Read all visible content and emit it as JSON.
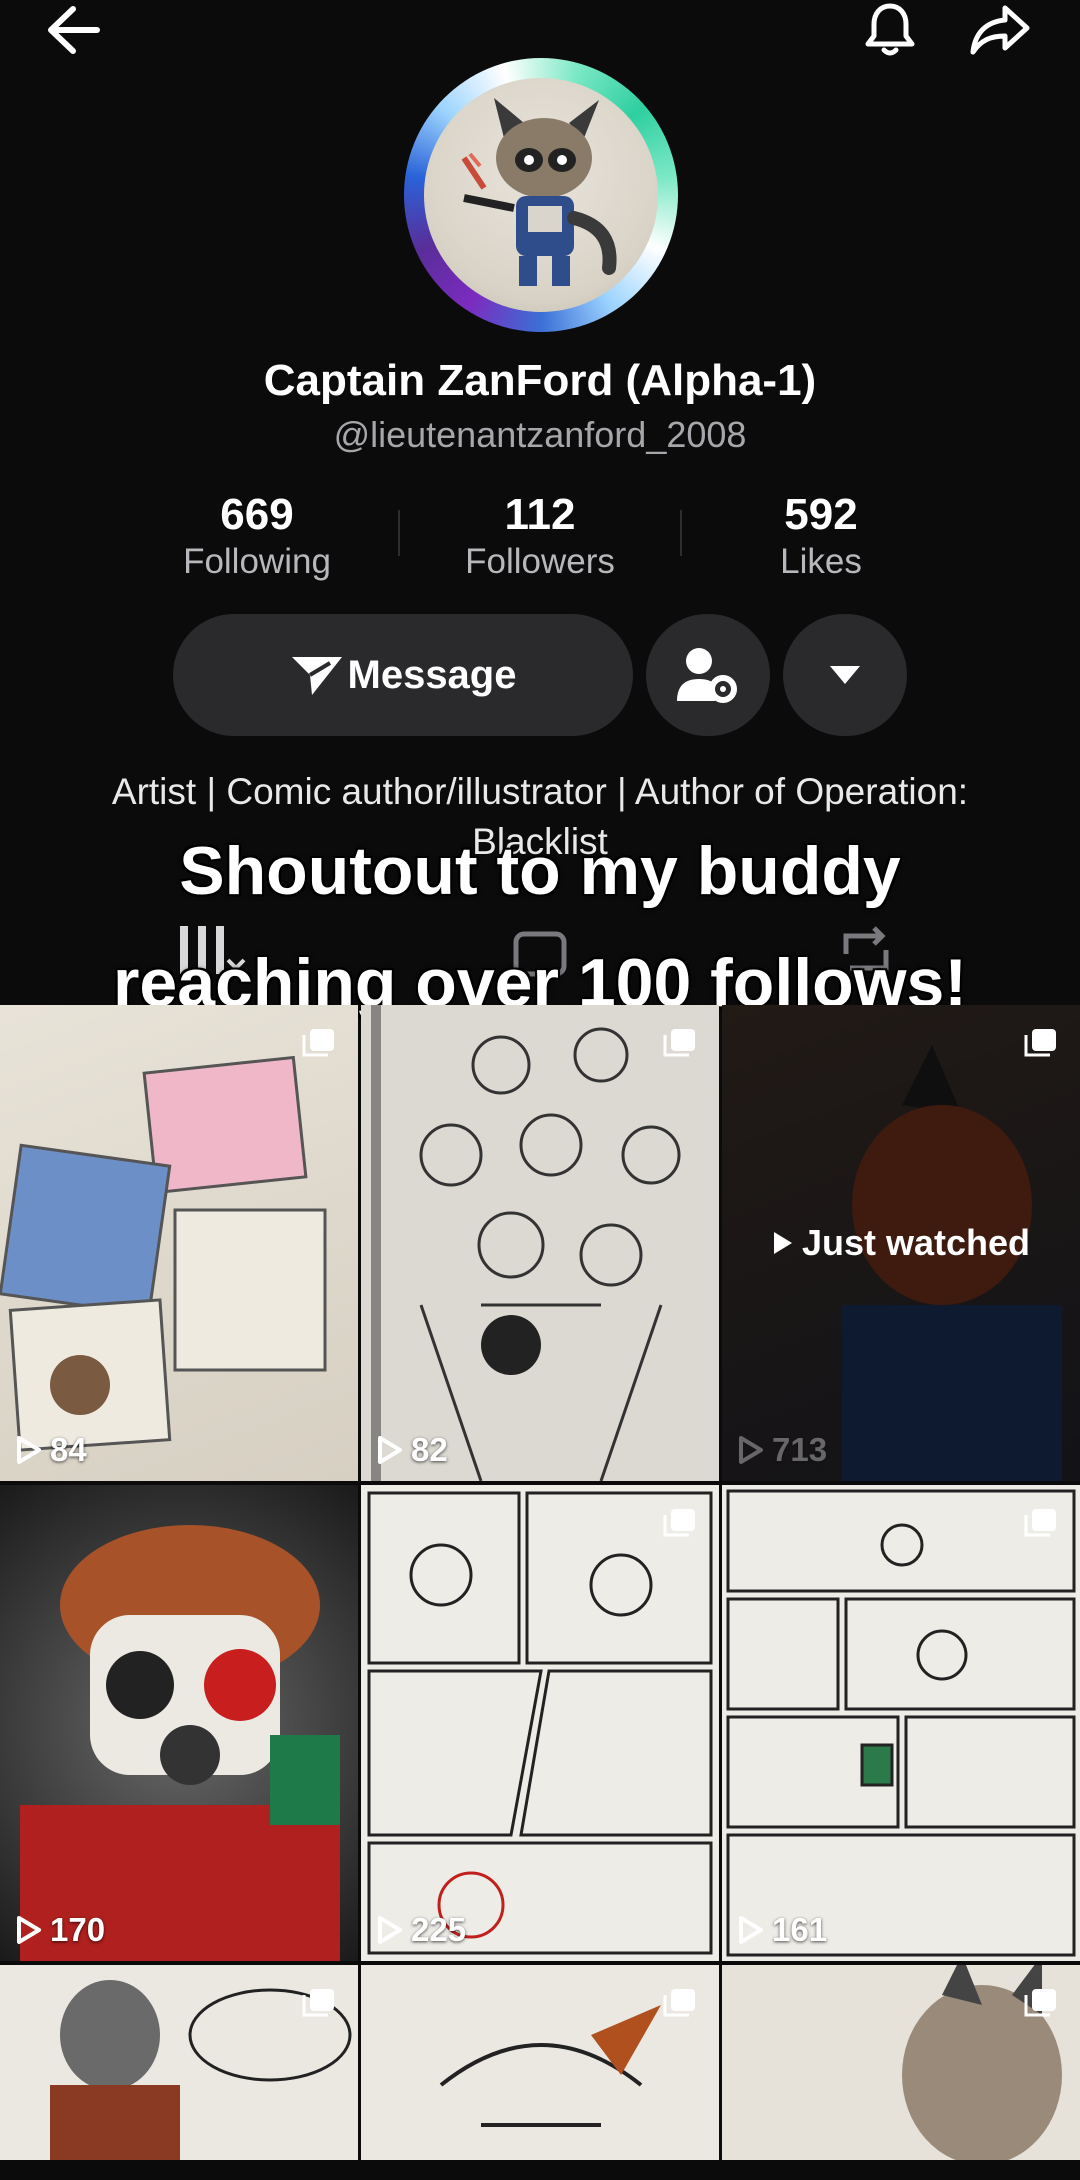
{
  "profile": {
    "display_name": "Captain ZanFord (Alpha-1)",
    "handle": "@lieutenantzanford_2008",
    "bio": "Artist | Comic author/illustrator | Author of Operation: Blacklist"
  },
  "stats": [
    {
      "value": "669",
      "label": "Following"
    },
    {
      "value": "112",
      "label": "Followers"
    },
    {
      "value": "592",
      "label": "Likes"
    }
  ],
  "actions": {
    "message_label": "Message"
  },
  "overlay": {
    "line1": "Shoutout to my buddy",
    "line2": "reaching over 100 follows!"
  },
  "videos": [
    {
      "views": "84"
    },
    {
      "views": "82"
    },
    {
      "views": "713",
      "status": "Just watched"
    },
    {
      "views": "170"
    },
    {
      "views": "225"
    },
    {
      "views": "161"
    },
    {
      "views": ""
    },
    {
      "views": ""
    },
    {
      "views": ""
    }
  ],
  "icons": [
    "back-arrow-icon",
    "bell-icon",
    "share-icon",
    "send-icon",
    "add-friend-settings-icon",
    "chevron-down-icon",
    "grid-icon",
    "lock-icon",
    "repost-icon",
    "multi-image-icon",
    "play-icon"
  ],
  "colors": {
    "background": "#0b0b0c",
    "button": "#2a2a2d",
    "muted_text": "#a7a7ab"
  }
}
